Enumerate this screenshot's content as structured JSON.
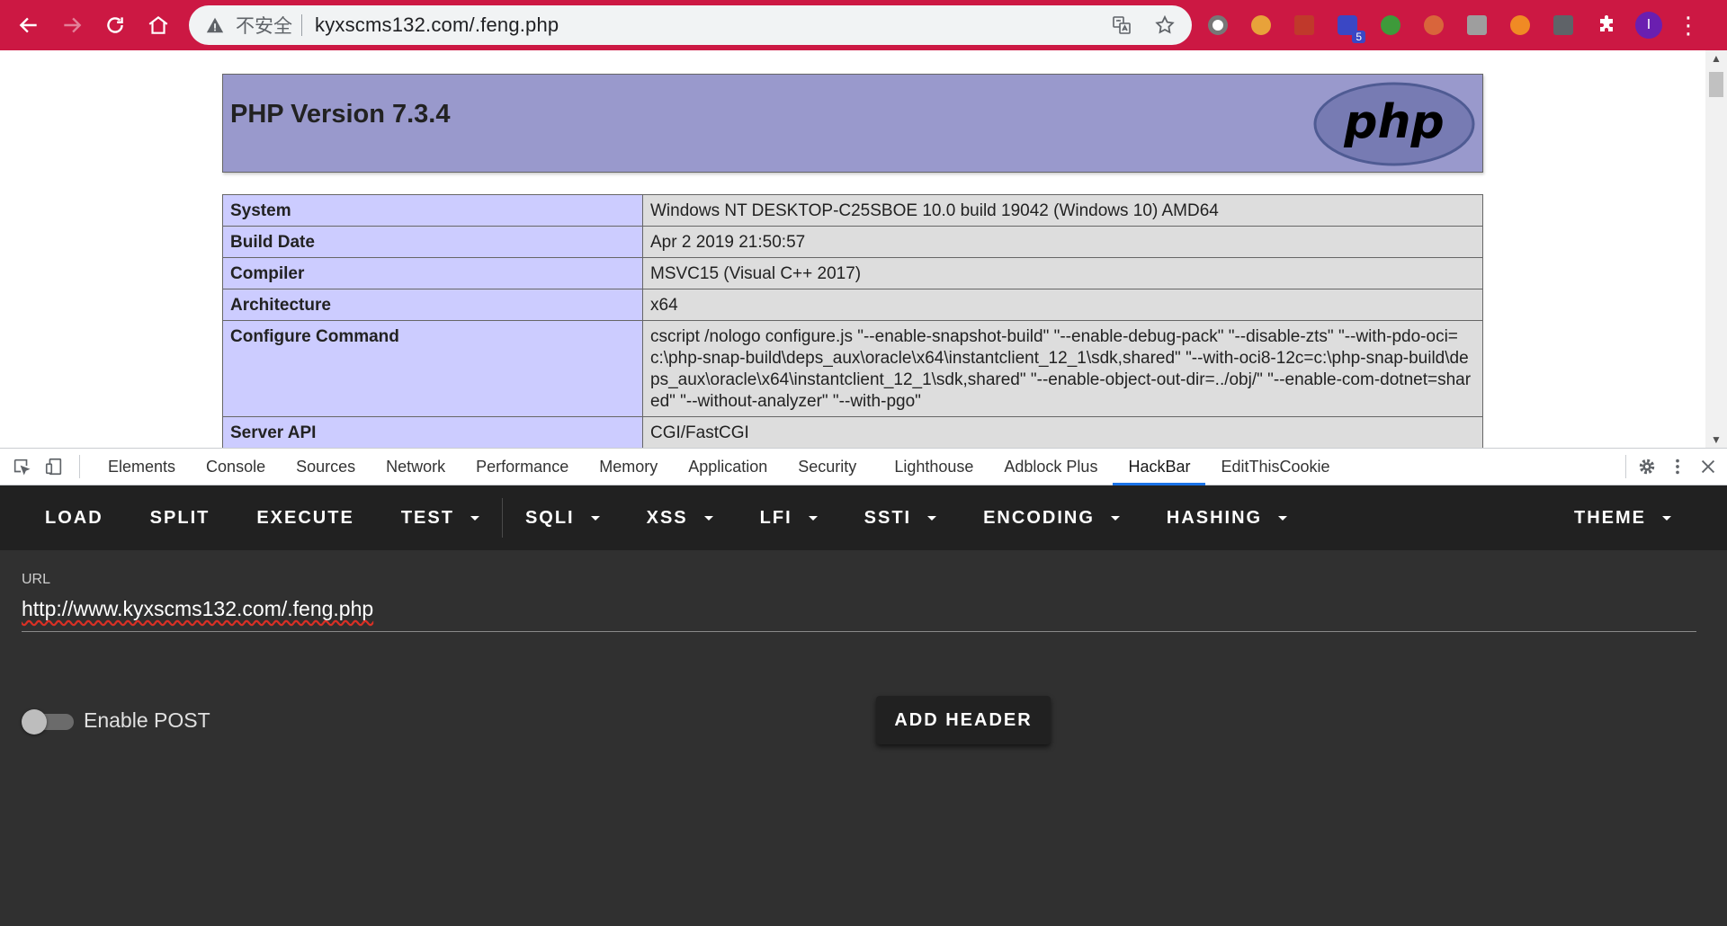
{
  "browser": {
    "insecure_label": "不安全",
    "address": "kyxscms132.com/.feng.php",
    "extension_badge": "5",
    "profile_initial": "I",
    "colors": {
      "toolbar": "#cc1843",
      "omnibox": "#f1f3f4"
    }
  },
  "phpinfo": {
    "title": "PHP Version 7.3.4",
    "logo_text": "php",
    "rows": [
      {
        "key": "System",
        "value": "Windows NT DESKTOP-C25SBOE 10.0 build 19042 (Windows 10) AMD64"
      },
      {
        "key": "Build Date",
        "value": "Apr 2 2019 21:50:57"
      },
      {
        "key": "Compiler",
        "value": "MSVC15 (Visual C++ 2017)"
      },
      {
        "key": "Architecture",
        "value": "x64"
      },
      {
        "key": "Configure Command",
        "value": "cscript /nologo configure.js \"--enable-snapshot-build\" \"--enable-debug-pack\" \"--disable-zts\" \"--with-pdo-oci=c:\\php-snap-build\\deps_aux\\oracle\\x64\\instantclient_12_1\\sdk,shared\" \"--with-oci8-12c=c:\\php-snap-build\\deps_aux\\oracle\\x64\\instantclient_12_1\\sdk,shared\" \"--enable-object-out-dir=../obj/\" \"--enable-com-dotnet=shared\" \"--without-analyzer\" \"--with-pgo\""
      },
      {
        "key": "Server API",
        "value": "CGI/FastCGI"
      }
    ]
  },
  "devtools": {
    "tabs": [
      "Elements",
      "Console",
      "Sources",
      "Network",
      "Performance",
      "Memory",
      "Application",
      "Security",
      "Lighthouse",
      "Adblock Plus",
      "HackBar",
      "EditThisCookie"
    ],
    "active_tab": "HackBar"
  },
  "hackbar": {
    "toolbar": {
      "load": "LOAD",
      "split": "SPLIT",
      "execute": "EXECUTE",
      "test": "TEST",
      "sqli": "SQLI",
      "xss": "XSS",
      "lfi": "LFI",
      "ssti": "SSTI",
      "encoding": "ENCODING",
      "hashing": "HASHING",
      "theme": "THEME"
    },
    "url_label": "URL",
    "url_value": "http://www.kyxscms132.com/.feng.php",
    "enable_post_label": "Enable POST",
    "enable_post": false,
    "add_header_label": "ADD HEADER"
  }
}
